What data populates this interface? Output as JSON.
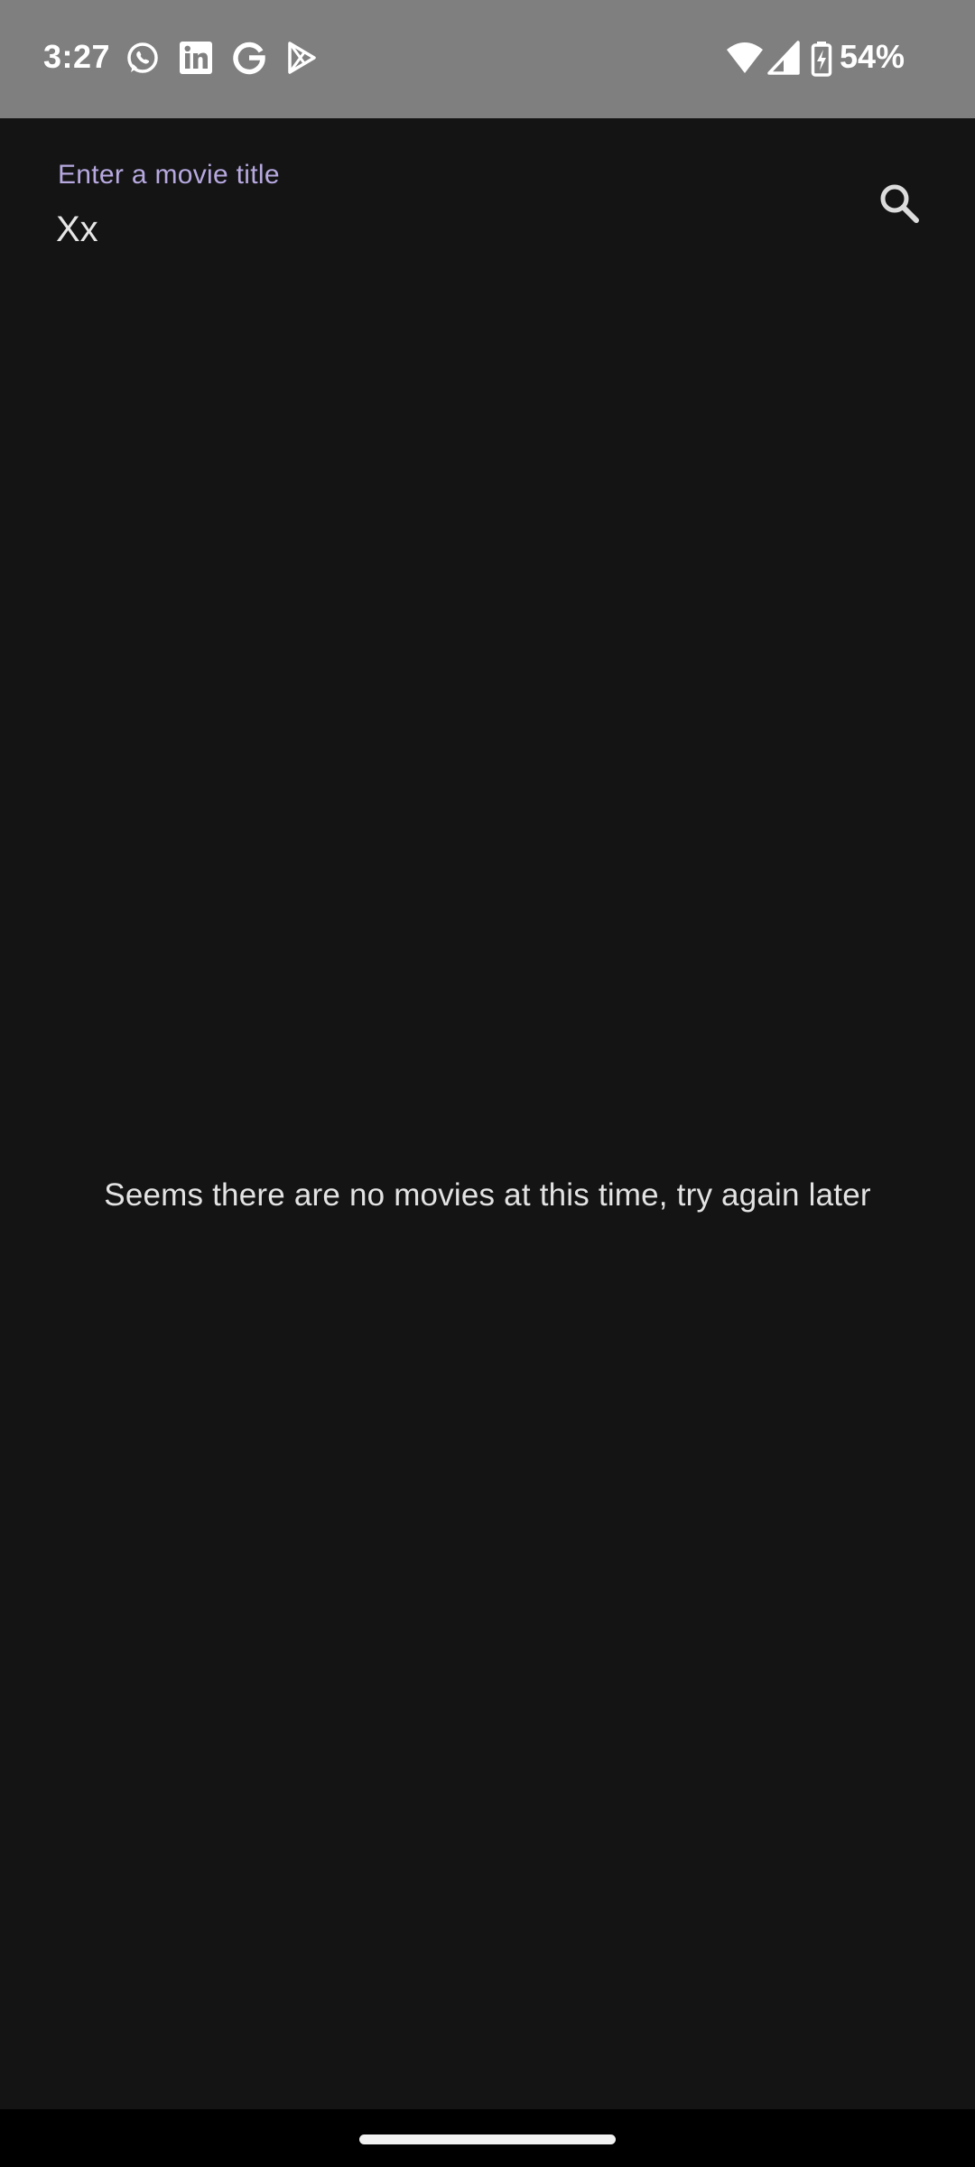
{
  "status_bar": {
    "time": "3:27",
    "notification_icons": [
      "whatsapp-icon",
      "linkedin-icon",
      "google-icon",
      "play-store-icon"
    ],
    "battery_percent": "54%"
  },
  "search": {
    "label": "Enter a movie title",
    "value": "Xx",
    "button_icon": "search-icon"
  },
  "main": {
    "empty_message": "Seems there are no movies at this time, try again later"
  },
  "colors": {
    "background": "#141414",
    "status_bar": "#7f7f7f",
    "label_accent": "#b7a9e0",
    "text": "#e6e6e6"
  }
}
